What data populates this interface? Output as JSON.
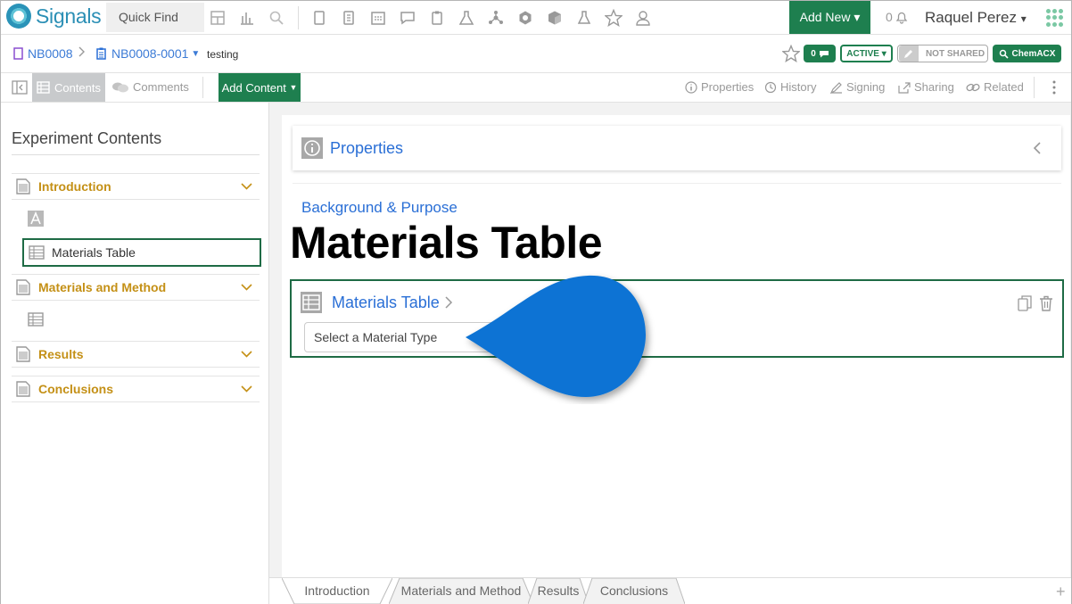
{
  "app": {
    "logo_text": "Signals",
    "quick_find": "Quick Find",
    "add_new": "Add New",
    "notifications_count": "0",
    "user_name": "Raquel Perez",
    "top_icons": [
      "dashboard-icon",
      "chart-icon",
      "search-icon",
      "notebook-icon",
      "journal-icon",
      "calendar-icon",
      "chat-icon",
      "clipboard-icon",
      "lab-icon",
      "structure-icon",
      "molecule-icon",
      "cube-icon",
      "flask-icon",
      "star-icon",
      "people-icon"
    ]
  },
  "breadcrumb": {
    "notebook": "NB0008",
    "experiment": "NB0008-0001",
    "name": "testing"
  },
  "header_badges": {
    "comments_count": "0",
    "status": "ACTIVE",
    "sharing": "NOT SHARED",
    "chemacx": "ChemACX"
  },
  "toolbar": {
    "contents": "Contents",
    "comments": "Comments",
    "add_content": "Add Content",
    "right_items": [
      "Properties",
      "History",
      "Signing",
      "Sharing",
      "Related"
    ]
  },
  "sidebar": {
    "title": "Experiment Contents",
    "sections": [
      {
        "label": "Introduction"
      },
      {
        "label": "Materials and Method"
      },
      {
        "label": "Results"
      },
      {
        "label": "Conclusions"
      }
    ],
    "selected_item": "Materials Table"
  },
  "main": {
    "properties_title": "Properties",
    "background_title": "Background & Purpose",
    "overlay_title": "Materials Table",
    "materials_card_title": "Materials Table",
    "material_type_placeholder": "Select a Material Type"
  },
  "tabs": [
    "Introduction",
    "Materials and Method",
    "Results",
    "Conclusions"
  ],
  "colors": {
    "green": "#1e7f4f",
    "link_blue": "#2a6fd6",
    "section_gold": "#c49016",
    "pin_blue": "#0a73d4"
  }
}
